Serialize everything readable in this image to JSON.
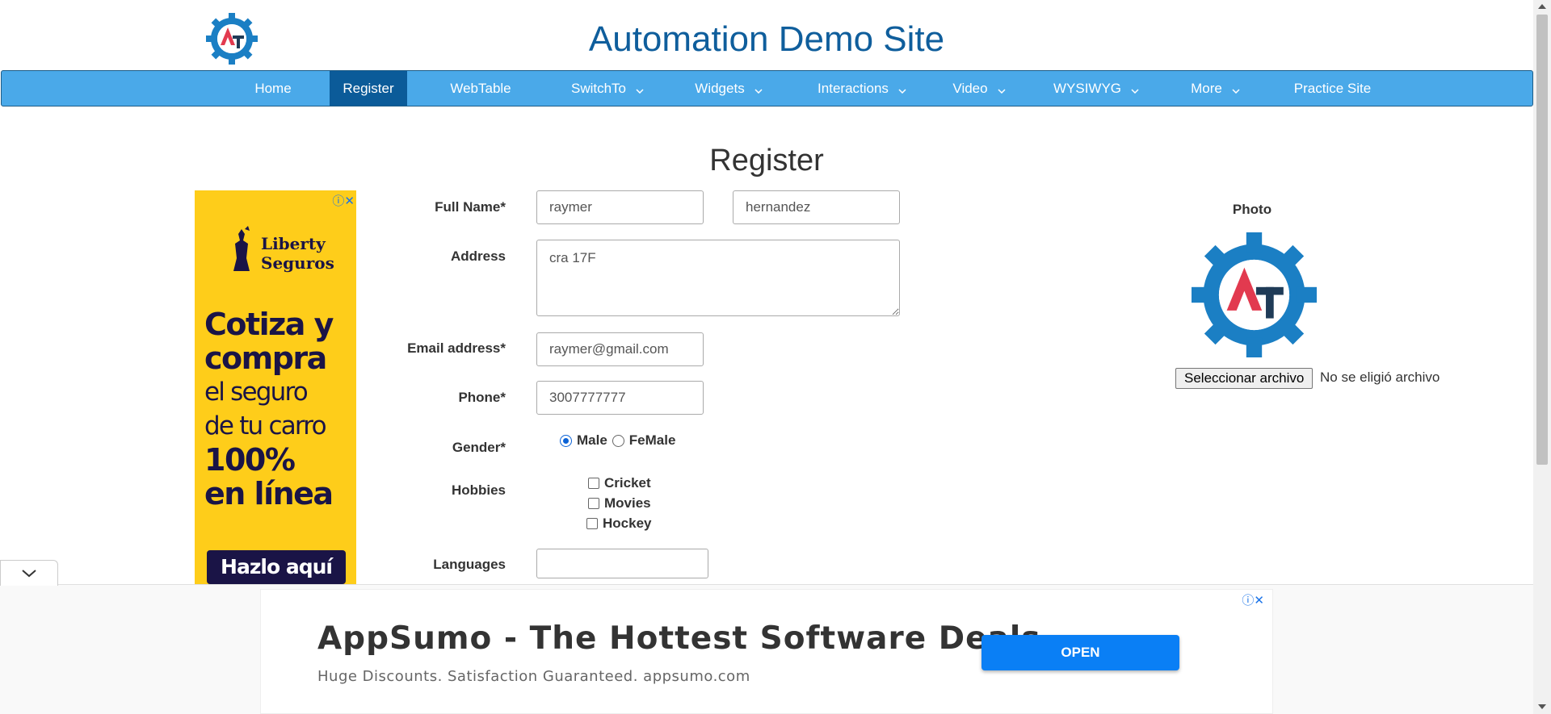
{
  "header": {
    "title": "Automation Demo Site"
  },
  "nav": {
    "items": [
      {
        "label": "Home"
      },
      {
        "label": "Register",
        "active": true
      },
      {
        "label": "WebTable"
      },
      {
        "label": "SwitchTo"
      },
      {
        "label": "Widgets"
      },
      {
        "label": "Interactions"
      },
      {
        "label": "Video"
      },
      {
        "label": "WYSIWYG"
      },
      {
        "label": "More"
      },
      {
        "label": "Practice Site"
      }
    ]
  },
  "form": {
    "heading": "Register",
    "full_name_label": "Full Name*",
    "first_name_value": "raymer",
    "last_name_value": "hernandez",
    "address_label": "Address",
    "address_value": "cra 17F",
    "email_label": "Email address*",
    "email_value": "raymer@gmail.com",
    "phone_label": "Phone*",
    "phone_value": "3007777777",
    "gender_label": "Gender*",
    "gender_options": [
      "Male",
      "FeMale"
    ],
    "gender_selected": "Male",
    "hobbies_label": "Hobbies",
    "hobbies": [
      "Cricket",
      "Movies",
      "Hockey"
    ],
    "languages_label": "Languages",
    "languages_value": ""
  },
  "photo": {
    "label": "Photo",
    "file_button": "Seleccionar archivo",
    "file_status": "No se eligió archivo"
  },
  "side_ad": {
    "brand_line1": "Liberty",
    "brand_line2": "Seguros",
    "line1": "Cotiza y",
    "line2": "compra",
    "line3": "el seguro",
    "line4": "de tu carro",
    "line5": "100%",
    "line6": "en línea",
    "cta": "Hazlo aquí",
    "color": "#fecd1a"
  },
  "bottom_ad": {
    "headline": "AppSumo - The Hottest Software Deals",
    "subline": "Huge Discounts. Satisfaction Guaranteed. appsumo.com",
    "button": "OPEN",
    "button_color": "#0a7ff5"
  },
  "colors": {
    "nav_bg": "#4aa9e9",
    "nav_active": "#0b5b99",
    "title": "#0f5e9c"
  }
}
